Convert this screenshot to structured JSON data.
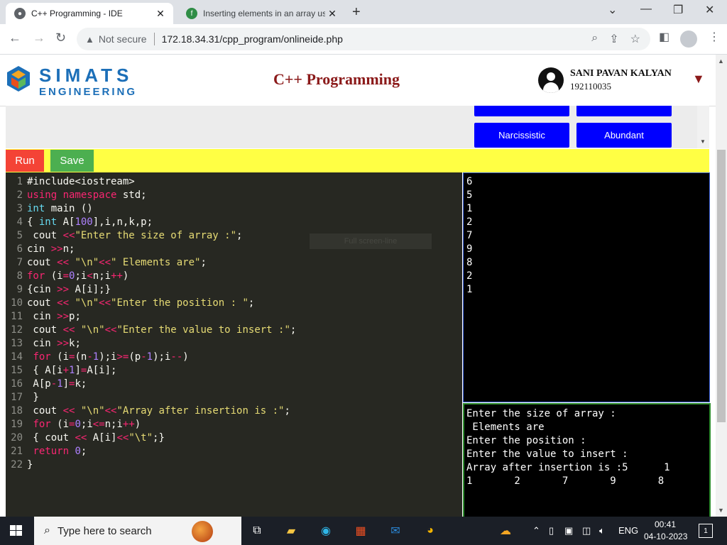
{
  "browser": {
    "tabs": [
      {
        "title": "C++ Programming - IDE",
        "close": "✕",
        "active": true
      },
      {
        "title": "Inserting elements in an array usi",
        "close": "✕",
        "active": false
      }
    ],
    "new_tab": "+",
    "security_label": "Not secure",
    "url": "172.18.34.31/cpp_program/onlineide.php"
  },
  "header": {
    "logo_line1": "SIMATS",
    "logo_line2": "ENGINEERING",
    "title": "C++ Programming",
    "user_name": "SANI PAVAN KALYAN",
    "user_id": "192110035",
    "caret": "▼"
  },
  "programs": [
    "Narcissistic",
    "Abundant"
  ],
  "actions": {
    "run": "Run",
    "save": "Save"
  },
  "editor": {
    "fullscreen_hint": "Full screen-line"
  },
  "input_values": [
    "6",
    "5",
    "1",
    "2",
    "7",
    "9",
    "8",
    "2",
    "1"
  ],
  "output_lines": [
    "Enter the size of array :",
    " Elements are",
    "Enter the position :",
    "Enter the value to insert :",
    "Array after insertion is :5      1",
    "1       2       7       9       8"
  ],
  "taskbar": {
    "search_placeholder": "Type here to search",
    "language": "ENG",
    "time": "00:41",
    "date": "04-10-2023",
    "notifications": "1"
  },
  "colors": {
    "accent_blue": "#0000ff",
    "run_red": "#f44336",
    "save_green": "#4caf50",
    "action_bar_yellow": "#ffff44",
    "title_maroon": "#8b1a1a"
  }
}
